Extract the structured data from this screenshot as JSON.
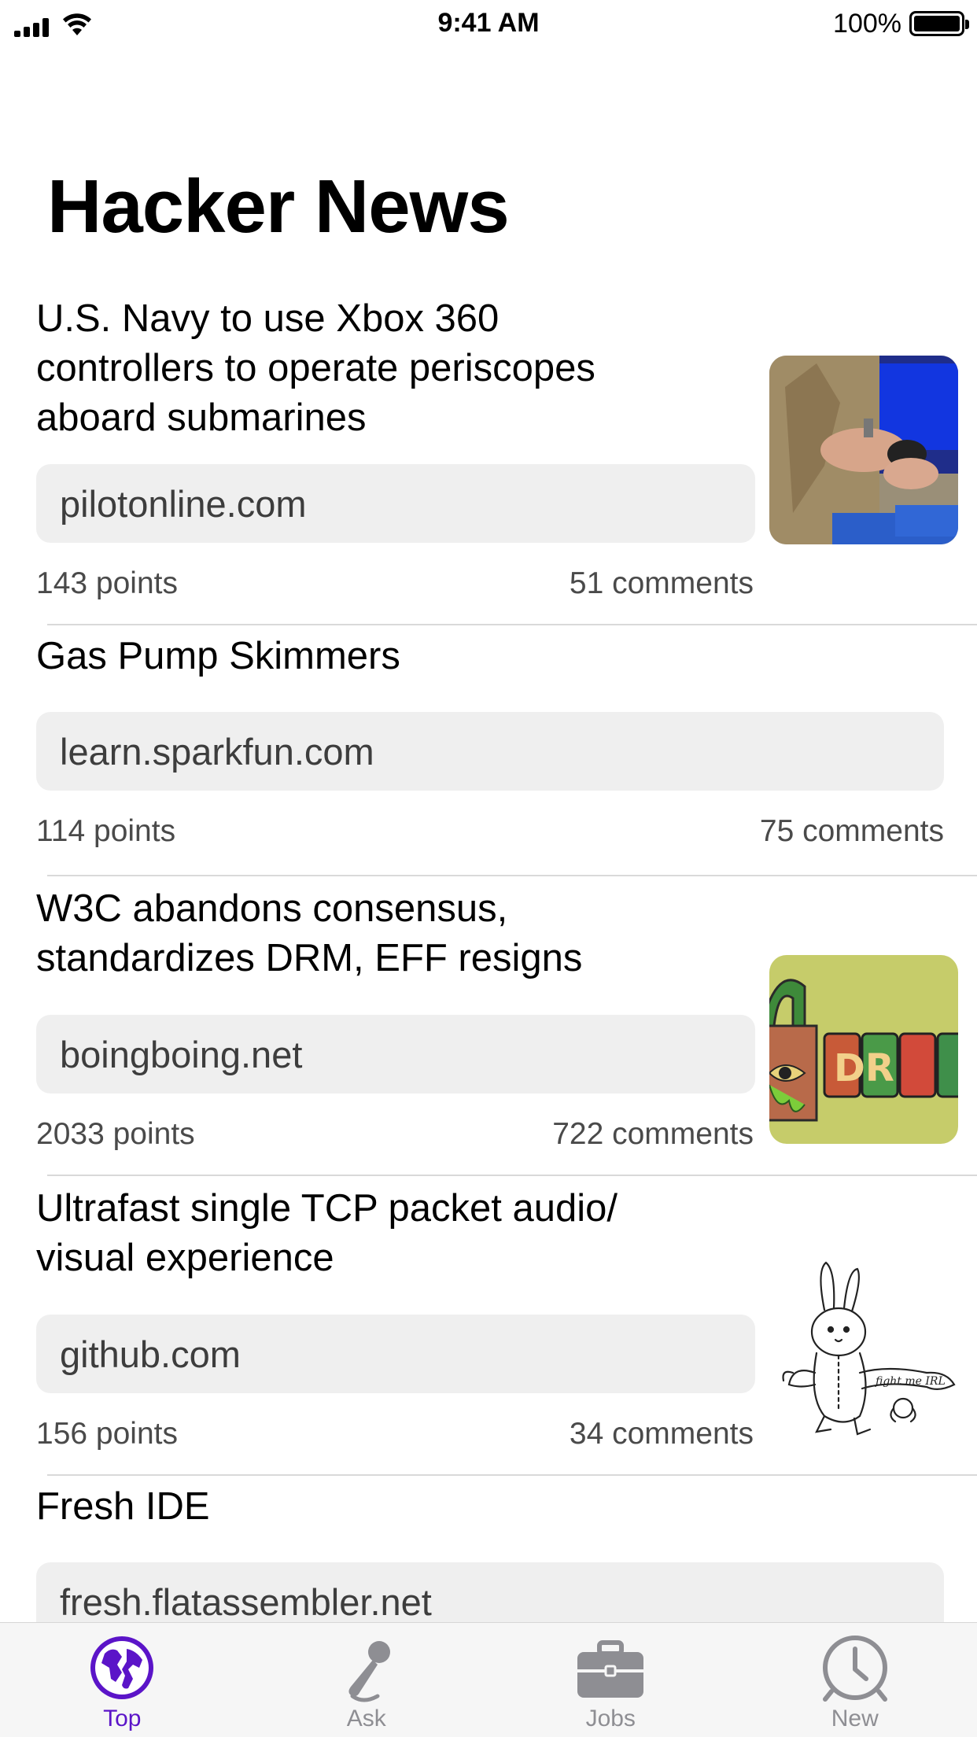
{
  "status_bar": {
    "time": "9:41 AM",
    "battery": "100%"
  },
  "header": {
    "title": "Hacker News"
  },
  "stories": [
    {
      "title": "U.S. Navy to use Xbox 360 controllers to operate periscopes aboard submarines",
      "title_lines": [
        "U.S. Navy to use Xbox 360",
        "controllers to operate periscopes",
        "aboard submarines"
      ],
      "url": "pilotonline.com",
      "points": "143 points",
      "comments": "51 comments",
      "thumbnail": "navy-controller-photo"
    },
    {
      "title": "Gas Pump Skimmers",
      "title_lines": [
        "Gas Pump Skimmers"
      ],
      "url": "learn.sparkfun.com",
      "points": "114 points",
      "comments": "75 comments",
      "thumbnail": ""
    },
    {
      "title": "W3C abandons consensus, standardizes DRM, EFF resigns",
      "title_lines": [
        "W3C abandons consensus,",
        "standardizes DRM, EFF resigns"
      ],
      "url": "boingboing.net",
      "points": "2033 points",
      "comments": "722 comments",
      "thumbnail": "drm-lock-illustration"
    },
    {
      "title": "Ultrafast single TCP packet audio/visual experience",
      "title_lines": [
        "Ultrafast single TCP packet audio/",
        "visual experience"
      ],
      "url": "github.com",
      "points": "156 points",
      "comments": "34 comments",
      "thumbnail": "bunny-sketch"
    },
    {
      "title": "Fresh IDE",
      "title_lines": [
        "Fresh IDE"
      ],
      "url": "fresh.flatassembler.net",
      "points": "",
      "comments": "",
      "thumbnail": ""
    }
  ],
  "tab_bar": {
    "items": [
      {
        "label": "Top",
        "icon": "globe-icon",
        "active": true
      },
      {
        "label": "Ask",
        "icon": "microphone-icon",
        "active": false
      },
      {
        "label": "Jobs",
        "icon": "briefcase-icon",
        "active": false
      },
      {
        "label": "New",
        "icon": "clock-icon",
        "active": false
      }
    ]
  },
  "colors": {
    "accent": "#5b14c8",
    "inactive": "#8e8e93",
    "pill_bg": "#efefef"
  }
}
